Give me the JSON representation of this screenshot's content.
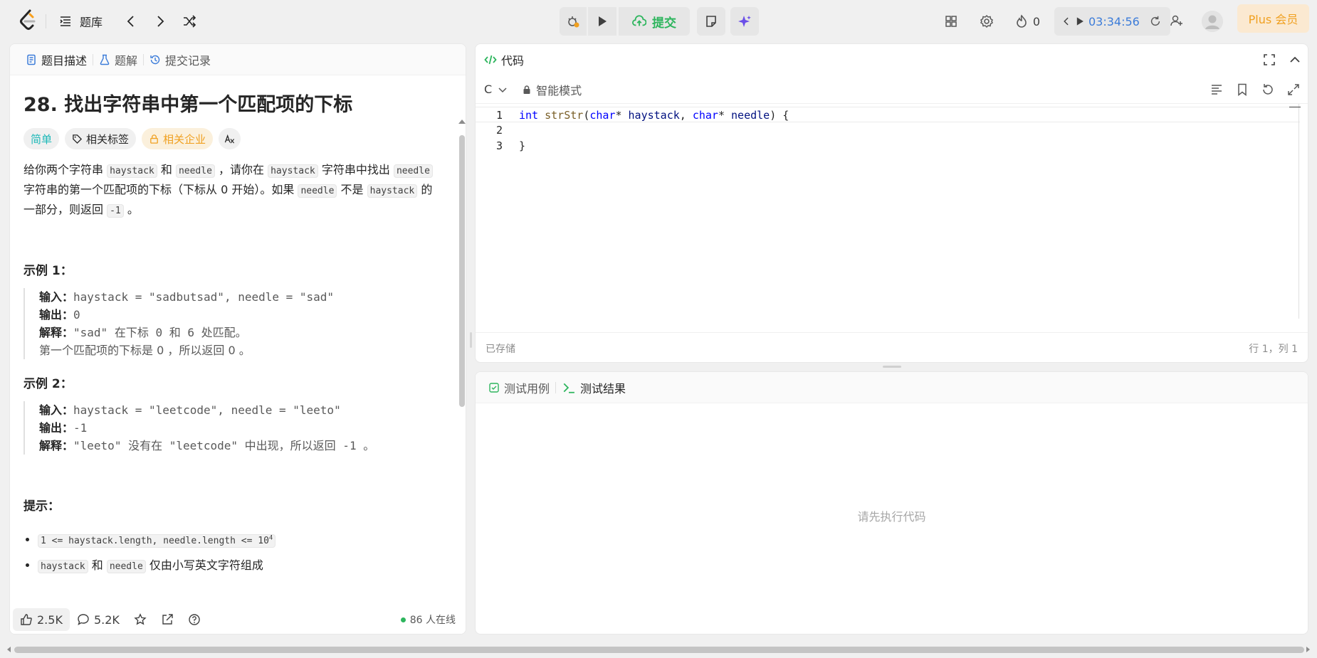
{
  "nav": {
    "problem_list": "题库",
    "submit": "提交",
    "streak": "0",
    "timer": "03:34:56",
    "plus": "Plus 会员"
  },
  "tabs": {
    "description": "题目描述",
    "solutions": "题解",
    "submissions": "提交记录"
  },
  "problem": {
    "title": "28. 找出字符串中第一个匹配项的下标",
    "tags": {
      "difficulty": "简单",
      "topics": "相关标签",
      "companies": "相关企业",
      "translate": "A文"
    },
    "desc_p1_a": "给你两个字符串",
    "desc_code_haystack": "haystack",
    "desc_p1_b": "和",
    "desc_code_needle": "needle",
    "desc_p1_c": "，请你在",
    "desc_code_haystack2": "haystack",
    "desc_p1_d": "字符串中找出",
    "desc_code_needle2": "needle",
    "desc_p1_e": "字符串的第一个匹配项的下标（下标从 0 开始）。如果",
    "desc_code_needle3": "needle",
    "desc_p1_f": "不是",
    "desc_code_haystack3": "haystack",
    "desc_p1_g": "的一部分，则返回",
    "desc_code_neg1": "-1",
    "desc_p1_h": "。",
    "example1": {
      "title": "示例 1：",
      "input_label": "输入：",
      "input": "haystack = \"sadbutsad\", needle = \"sad\"",
      "output_label": "输出：",
      "output": "0",
      "expl_label": "解释：",
      "expl": "\"sad\" 在下标 0 和 6 处匹配。",
      "expl2": "第一个匹配项的下标是 0 ，所以返回 0 。"
    },
    "example2": {
      "title": "示例 2：",
      "input_label": "输入：",
      "input": "haystack = \"leetcode\", needle = \"leeto\"",
      "output_label": "输出：",
      "output": "-1",
      "expl_label": "解释：",
      "expl": "\"leeto\" 没有在 \"leetcode\" 中出现，所以返回 -1 。"
    },
    "hints_title": "提示：",
    "hint1": "1 <= haystack.length, needle.length <= 10",
    "hint1_sup": "4",
    "hint2_code1": "haystack",
    "hint2_mid": "和",
    "hint2_code2": "needle",
    "hint2_tail": "仅由小写英文字符组成"
  },
  "footer": {
    "likes": "2.5K",
    "comments": "5.2K",
    "online": "86 人在线"
  },
  "code": {
    "title": "代码",
    "language": "C",
    "mode": "智能模式",
    "lines": [
      {
        "n": "1"
      },
      {
        "n": "2"
      },
      {
        "n": "3"
      }
    ],
    "l1_kw": "int",
    "l1_fn": "strStr",
    "l1_p1": "(",
    "l1_t1": "char",
    "l1_p2": "* ",
    "l1_a1": "haystack",
    "l1_p3": ", ",
    "l1_t2": "char",
    "l1_p4": "* ",
    "l1_a2": "needle",
    "l1_p5": ") {",
    "l3": "}",
    "saved": "已存储",
    "cursor": "行 1，列 1"
  },
  "result": {
    "tab_cases": "测试用例",
    "tab_result": "测试结果",
    "empty": "请先执行代码"
  },
  "colors": {
    "submit_green": "#2db55d",
    "timer_blue": "#3c7cd9",
    "easy_teal": "#1cb8b8",
    "plus_orange": "#f0a020"
  }
}
